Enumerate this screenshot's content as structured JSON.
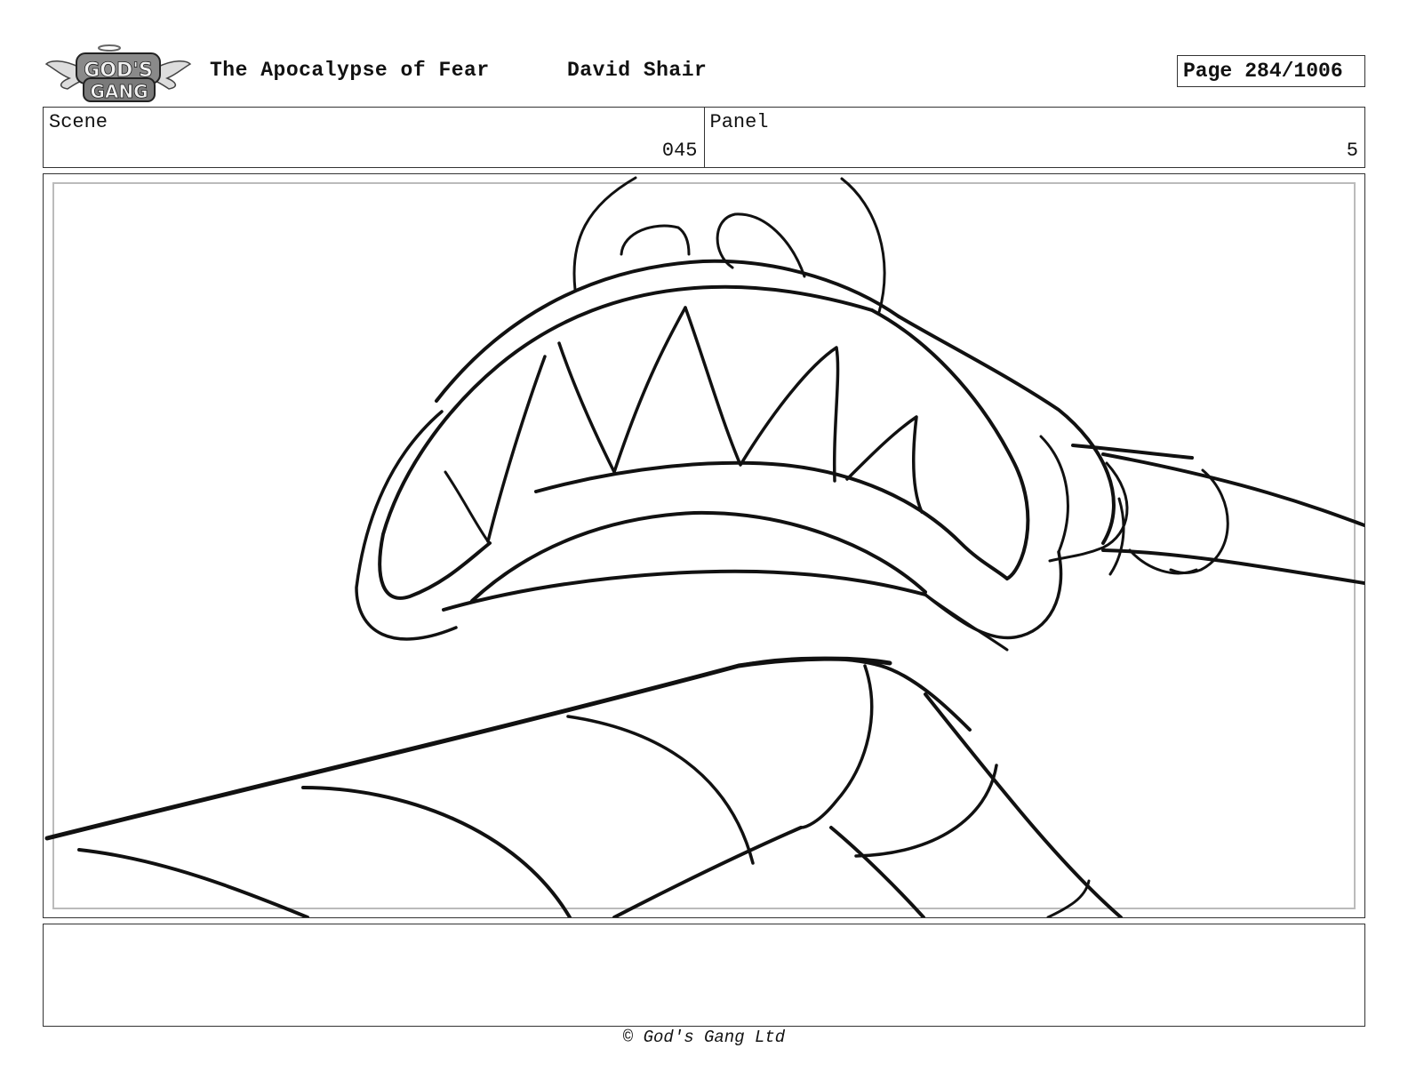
{
  "header": {
    "logo_text": "GOD'S GANG",
    "title": "The Apocalypse of Fear",
    "author": "David Shair",
    "page_label": "Page",
    "page_number": "284/1006"
  },
  "info": {
    "scene_label": "Scene",
    "scene_value": "045",
    "panel_label": "Panel",
    "panel_value": "5"
  },
  "notes": {
    "text": ""
  },
  "footer": {
    "copyright": "© God's Gang Ltd"
  }
}
